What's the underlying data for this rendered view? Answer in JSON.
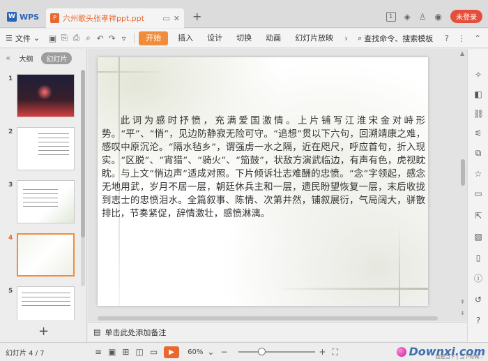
{
  "app": {
    "wps_tab_label": "WPS",
    "doc_tab_label": "六州歌头张孝祥ppt.ppt",
    "login_label": "未登录",
    "window_count_badge": "1"
  },
  "toolbar": {
    "file_menu_label": "文件",
    "ribbon_tabs": [
      "开始",
      "插入",
      "设计",
      "切换",
      "动画",
      "幻灯片放映"
    ],
    "search_label": "查找命令、搜索模板"
  },
  "left_panel": {
    "tab_outline": "大纲",
    "tab_slides": "幻灯片",
    "slide_numbers": [
      "1",
      "2",
      "3",
      "4",
      "5"
    ],
    "active_slide_index": 4
  },
  "slide": {
    "body_text": "此词为感时抒愤，充满爱国激情。上片铺写江淮宋金对峙形势。“平”、“悄”，见边防静寂无险可守。“追想”贯以下六句，回溯靖康之难，感叹中原沉沦。“隔水毡乡”，谓强虏一水之隔，近在咫尺，呼应首句，折入现实。“区脱”、“宵猎”、“骑火”、“笳鼓”，状敌方演武临边，有声有色，虎视眈眈。与上文“悄边声”适成对照。下片倾诉壮志难酬的忠愤。“念”字领起，感念无地用武，岁月不居一层，朝廷休兵主和一层，遗民盼望恢复一层，末后收拢到志士的忠愤泪水。全篇叙事、陈情、次第井然，铺叙展衍，气局阔大，骈散排比，节奏紧促，辞情激壮，感愤淋漓。"
  },
  "notes": {
    "placeholder": "单击此处添加备注"
  },
  "status": {
    "page_indicator": "幻灯片 4 / 7",
    "zoom_label": "60%",
    "zoom_fraction": 0.3,
    "watermark": "Downxi.com",
    "watermark_sub": "我是当下 | 当下你做..."
  },
  "colors": {
    "accent": "#f08d3b",
    "doc_tab_text": "#e8682f",
    "login_bg": "#e44e3a",
    "wps_blue": "#2b63b8"
  }
}
